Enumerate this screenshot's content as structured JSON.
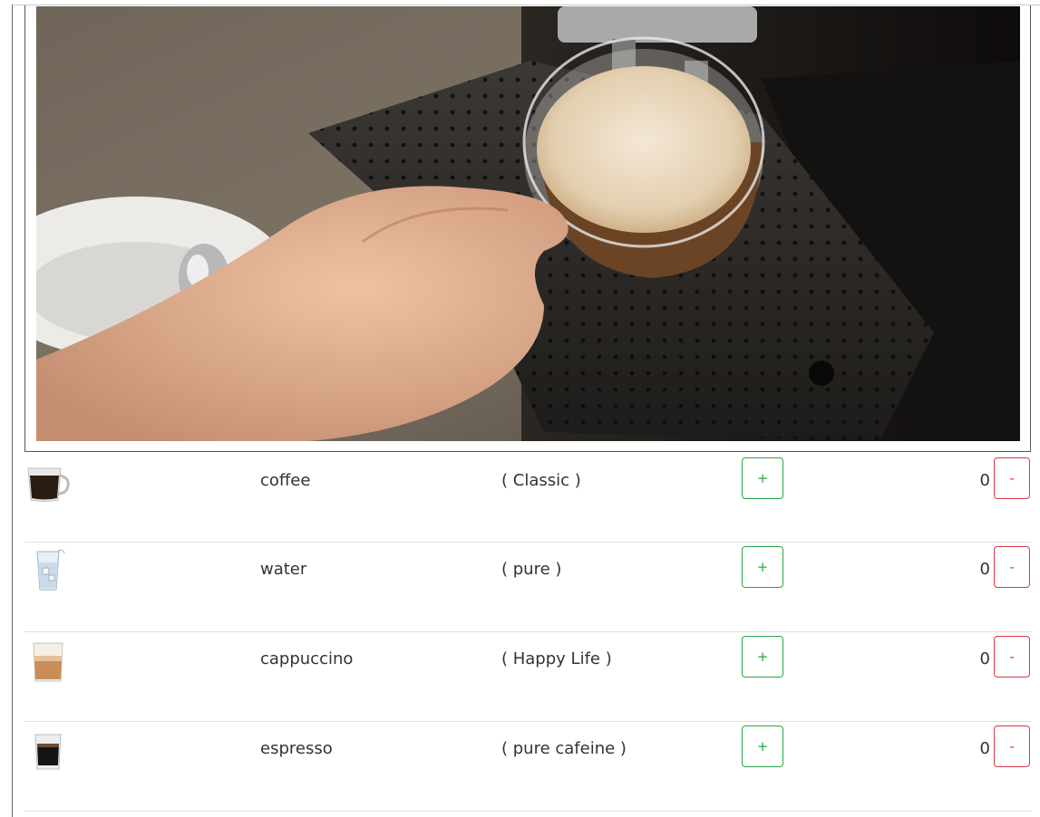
{
  "products": [
    {
      "name": "coffee",
      "desc": "( Classic )",
      "qty": "0",
      "plus": "+",
      "minus": "-",
      "icon": "coffee-mug-icon"
    },
    {
      "name": "water",
      "desc": "( pure )",
      "qty": "0",
      "plus": "+",
      "minus": "-",
      "icon": "water-glass-icon"
    },
    {
      "name": "cappuccino",
      "desc": "( Happy Life )",
      "qty": "0",
      "plus": "+",
      "minus": "-",
      "icon": "cappuccino-glass-icon"
    },
    {
      "name": "espresso",
      "desc": "( pure cafeine )",
      "qty": "0",
      "plus": "+",
      "minus": "-",
      "icon": "espresso-glass-icon"
    }
  ],
  "colors": {
    "plus": "#28a745",
    "minus": "#dc3545",
    "divider": "#dee2e6"
  }
}
